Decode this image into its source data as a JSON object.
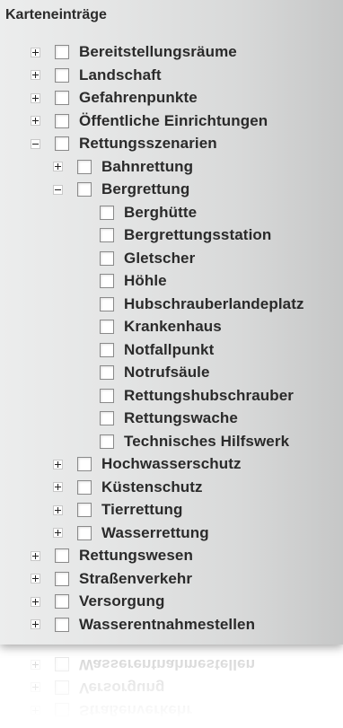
{
  "panel": {
    "title": "Karteneinträge"
  },
  "tree": [
    {
      "label": "Bereitstellungsräume",
      "level": 0,
      "toggle": "collapsed"
    },
    {
      "label": "Landschaft",
      "level": 0,
      "toggle": "collapsed"
    },
    {
      "label": "Gefahrenpunkte",
      "level": 0,
      "toggle": "collapsed"
    },
    {
      "label": "Öffentliche Einrichtungen",
      "level": 0,
      "toggle": "collapsed"
    },
    {
      "label": "Rettungsszenarien",
      "level": 0,
      "toggle": "expanded"
    },
    {
      "label": "Bahnrettung",
      "level": 1,
      "toggle": "collapsed"
    },
    {
      "label": "Bergrettung",
      "level": 1,
      "toggle": "expanded"
    },
    {
      "label": "Berghütte",
      "level": 2,
      "toggle": "none"
    },
    {
      "label": "Bergrettungsstation",
      "level": 2,
      "toggle": "none"
    },
    {
      "label": "Gletscher",
      "level": 2,
      "toggle": "none"
    },
    {
      "label": "Höhle",
      "level": 2,
      "toggle": "none"
    },
    {
      "label": "Hubschrauberlandeplatz",
      "level": 2,
      "toggle": "none"
    },
    {
      "label": "Krankenhaus",
      "level": 2,
      "toggle": "none"
    },
    {
      "label": "Notfallpunkt",
      "level": 2,
      "toggle": "none"
    },
    {
      "label": "Notrufsäule",
      "level": 2,
      "toggle": "none"
    },
    {
      "label": "Rettungshubschrauber",
      "level": 2,
      "toggle": "none"
    },
    {
      "label": "Rettungswache",
      "level": 2,
      "toggle": "none"
    },
    {
      "label": "Technisches Hilfswerk",
      "level": 2,
      "toggle": "none"
    },
    {
      "label": "Hochwasserschutz",
      "level": 1,
      "toggle": "collapsed"
    },
    {
      "label": "Küstenschutz",
      "level": 1,
      "toggle": "collapsed"
    },
    {
      "label": "Tierrettung",
      "level": 1,
      "toggle": "collapsed"
    },
    {
      "label": "Wasserrettung",
      "level": 1,
      "toggle": "collapsed"
    },
    {
      "label": "Rettungswesen",
      "level": 0,
      "toggle": "collapsed"
    },
    {
      "label": "Straßenverkehr",
      "level": 0,
      "toggle": "collapsed"
    },
    {
      "label": "Versorgung",
      "level": 0,
      "toggle": "collapsed"
    },
    {
      "label": "Wasserentnahmestellen",
      "level": 0,
      "toggle": "collapsed"
    }
  ]
}
